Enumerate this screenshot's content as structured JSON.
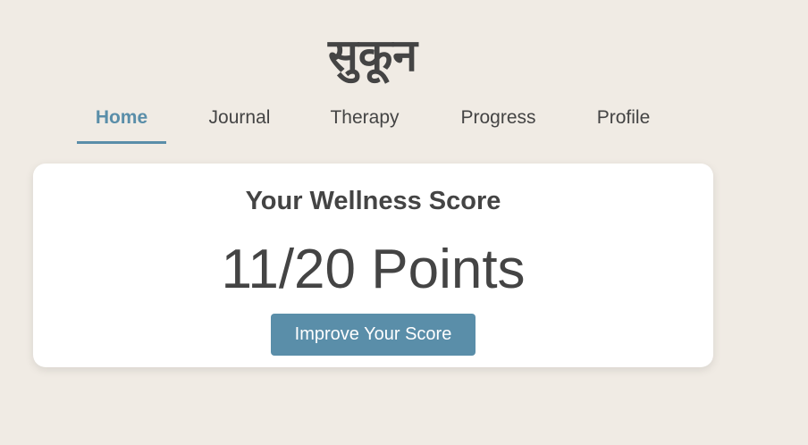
{
  "app": {
    "title": "सुकून"
  },
  "nav": {
    "active": "Home",
    "items": [
      {
        "label": "Home"
      },
      {
        "label": "Journal"
      },
      {
        "label": "Therapy"
      },
      {
        "label": "Progress"
      },
      {
        "label": "Profile"
      }
    ]
  },
  "wellness": {
    "title": "Your Wellness Score",
    "score_text": "11/20 Points",
    "score": 11,
    "max_score": 20,
    "button_label": "Improve Your Score"
  },
  "colors": {
    "background": "#f0ebe4",
    "accent": "#5a8ea9",
    "text": "#444444",
    "card": "#ffffff"
  }
}
